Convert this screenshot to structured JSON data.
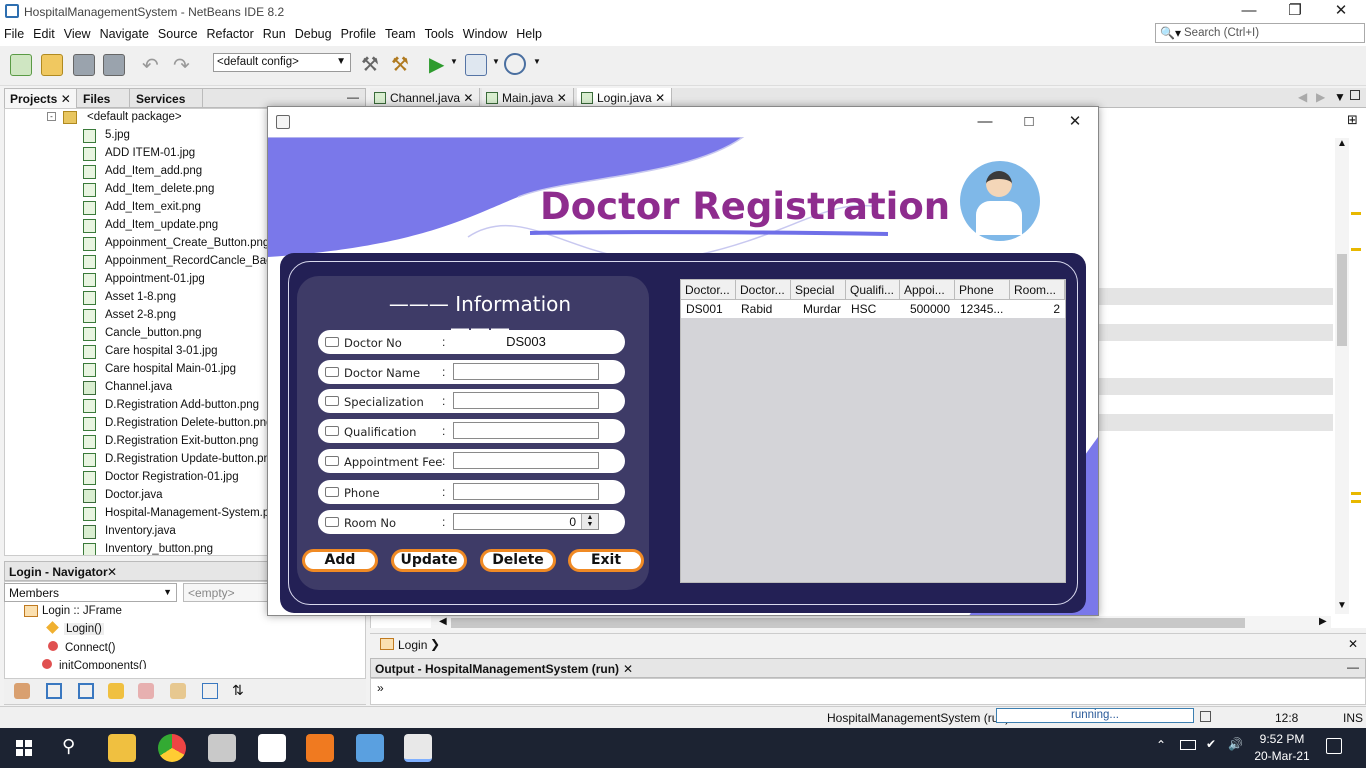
{
  "window": {
    "title": "HospitalManagementSystem - NetBeans IDE 8.2"
  },
  "menu": [
    "File",
    "Edit",
    "View",
    "Navigate",
    "Source",
    "Refactor",
    "Run",
    "Debug",
    "Profile",
    "Team",
    "Tools",
    "Window",
    "Help"
  ],
  "search": {
    "placeholder": "Search (Ctrl+I)"
  },
  "toolbar": {
    "config": "<default config>"
  },
  "left_tabs": [
    "Projects",
    "Files",
    "Services"
  ],
  "tree": {
    "package": "<default package>",
    "files": [
      "5.jpg",
      "ADD ITEM-01.jpg",
      "Add_Item_add.png",
      "Add_Item_delete.png",
      "Add_Item_exit.png",
      "Add_Item_update.png",
      "Appoinment_Create_Button.png",
      "Appoinment_RecordCancle_Back B",
      "Appointment-01.jpg",
      "Asset 1-8.png",
      "Asset 2-8.png",
      "Cancle_button.png",
      "Care hospital 3-01.jpg",
      "Care hospital Main-01.jpg",
      "Channel.java",
      "D.Registration Add-button.png",
      "D.Registration Delete-button.png",
      "D.Registration Exit-button.png",
      "D.Registration Update-button.png",
      "Doctor Registration-01.jpg",
      "Doctor.java",
      "Hospital-Management-System.png",
      "Inventory.java",
      "Inventory_button.png"
    ]
  },
  "navigator": {
    "title": "Login - Navigator",
    "members": "Members",
    "filter": "<empty>",
    "root": "Login :: JFrame",
    "items": [
      "Login()",
      "Connect()",
      "initComponents()"
    ]
  },
  "editor_tabs": [
    "Channel.java",
    "Main.java",
    "Login.java"
  ],
  "breadcrumb": "Login",
  "output": {
    "title": "Output - HospitalManagementSystem (run)",
    "prompt": "»"
  },
  "status": {
    "project": "HospitalManagementSystem (run)",
    "progress": "running...",
    "position": "12:8",
    "mode": "INS"
  },
  "clock": {
    "time": "9:52 PM",
    "date": "20-Mar-21"
  },
  "app": {
    "heading": "Doctor Registration",
    "info_title": "Information",
    "fields": [
      {
        "label": "Doctor No",
        "value": "DS003"
      },
      {
        "label": "Doctor Name",
        "value": ""
      },
      {
        "label": "Specialization",
        "value": ""
      },
      {
        "label": "Qualification",
        "value": ""
      },
      {
        "label": "Appointment Fee",
        "value": ""
      },
      {
        "label": "Phone",
        "value": ""
      },
      {
        "label": "Room No",
        "value": "0"
      }
    ],
    "buttons": [
      "Add",
      "Update",
      "Delete",
      "Exit"
    ],
    "table": {
      "columns": [
        "Doctor...",
        "Doctor...",
        "Special",
        "Qualifi...",
        "Appoi...",
        "Phone",
        "Room..."
      ],
      "rows": [
        [
          "DS001",
          "Rabid",
          "Murdar",
          "HSC",
          "500000",
          "12345...",
          "2"
        ]
      ]
    }
  },
  "colors": {
    "heading": "#8e2c8e",
    "panel": "#232055",
    "card": "#3e3b67",
    "button_border": "#f08a24",
    "accent_wave": "#6f6fe8"
  }
}
